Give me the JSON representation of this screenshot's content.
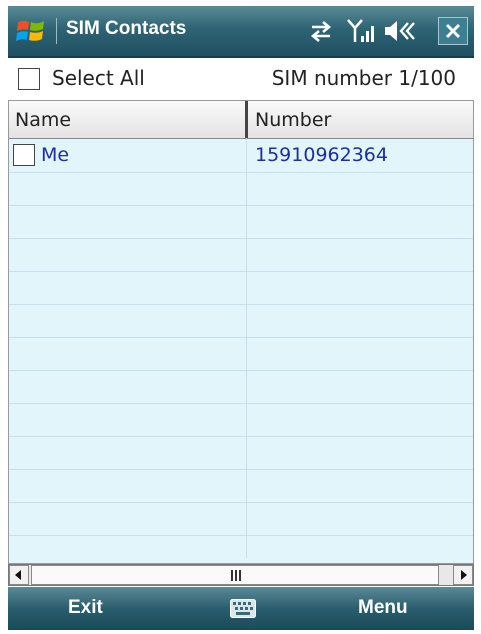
{
  "titlebar": {
    "title": "SIM Contacts",
    "icons": [
      "windows-start-icon",
      "sync-arrows-icon",
      "signal-icon",
      "volume-icon",
      "close-icon"
    ],
    "close_label": "X"
  },
  "toolbar": {
    "select_all_label": "Select All",
    "select_all_checked": false,
    "sim_number_text": "SIM number 1/100"
  },
  "table": {
    "columns": [
      "Name",
      "Number"
    ],
    "rows": [
      {
        "name": "Me",
        "number": "15910962364",
        "checked": false
      }
    ]
  },
  "scrollbar": {
    "left_arrow": "◀",
    "right_arrow": "▶"
  },
  "softkeys": {
    "left": "Exit",
    "right": "Menu",
    "center_icon": "keyboard-icon"
  },
  "colors": {
    "titlebar": "#2e6474",
    "list_background": "#e2f5fb",
    "row_text": "#1c2fa0"
  }
}
